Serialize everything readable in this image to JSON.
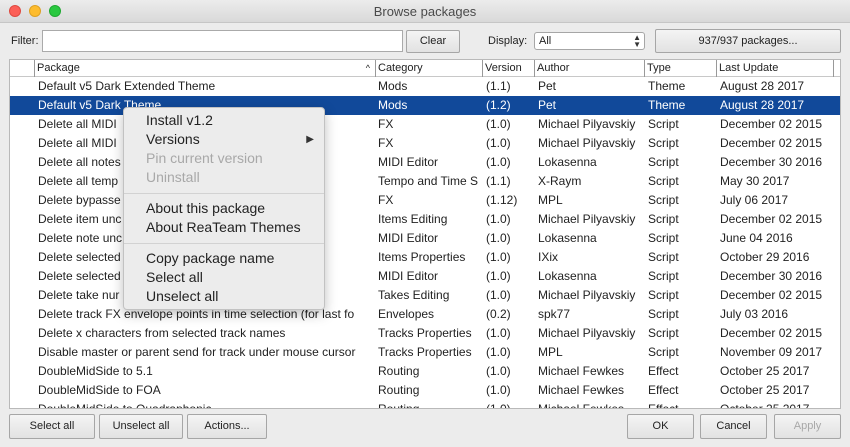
{
  "window": {
    "title": "Browse packages"
  },
  "filter": {
    "label": "Filter:",
    "value": "",
    "clear_label": "Clear"
  },
  "display": {
    "label": "Display:",
    "selected": "All"
  },
  "packages_button": "937/937 packages...",
  "columns": [
    "Package",
    "Category",
    "Version",
    "Author",
    "Type",
    "Last Update"
  ],
  "rows": [
    {
      "package": "Default v5 Dark Extended Theme",
      "category": "Mods",
      "version": "(1.1)",
      "author": "Pet",
      "type": "Theme",
      "updated": "August 28 2017"
    },
    {
      "package": "Default v5 Dark Theme",
      "category": "Mods",
      "version": "(1.2)",
      "author": "Pet",
      "type": "Theme",
      "updated": "August 28 2017",
      "selected": true
    },
    {
      "package": "Delete all MIDI",
      "category": "FX",
      "version": "(1.0)",
      "author": "Michael Pilyavskiy",
      "type": "Script",
      "updated": "December 02 2015"
    },
    {
      "package": "Delete all MIDI",
      "category": "FX",
      "version": "(1.0)",
      "author": "Michael Pilyavskiy",
      "type": "Script",
      "updated": "December 02 2015"
    },
    {
      "package": "Delete all notes",
      "category": "MIDI Editor",
      "version": "(1.0)",
      "author": "Lokasenna",
      "type": "Script",
      "updated": "December 30 2016"
    },
    {
      "package": "Delete all temp",
      "category": "Tempo and Time S",
      "version": "(1.1)",
      "author": "X-Raym",
      "type": "Script",
      "updated": "May 30 2017"
    },
    {
      "package": "Delete bypasse",
      "category": "FX",
      "version": "(1.12)",
      "author": "MPL",
      "type": "Script",
      "updated": "July 06 2017"
    },
    {
      "package": "Delete item unc",
      "category": "Items Editing",
      "version": "(1.0)",
      "author": "Michael Pilyavskiy",
      "type": "Script",
      "updated": "December 02 2015"
    },
    {
      "package": "Delete note unc",
      "category": "MIDI Editor",
      "version": "(1.0)",
      "author": "Lokasenna",
      "type": "Script",
      "updated": "June 04 2016"
    },
    {
      "package": "Delete selected",
      "category": "Items Properties",
      "version": "(1.0)",
      "author": "IXix",
      "type": "Script",
      "updated": "October 29 2016"
    },
    {
      "package": "Delete selected",
      "category": "MIDI Editor",
      "version": "(1.0)",
      "author": "Lokasenna",
      "type": "Script",
      "updated": "December 30 2016"
    },
    {
      "package": "Delete take nur",
      "category": "Takes Editing",
      "version": "(1.0)",
      "author": "Michael Pilyavskiy",
      "type": "Script",
      "updated": "December 02 2015"
    },
    {
      "package": "Delete track FX envelope points in time selection (for last fo",
      "category": "Envelopes",
      "version": "(0.2)",
      "author": "spk77",
      "type": "Script",
      "updated": "July 03 2016"
    },
    {
      "package": "Delete x characters from selected track names",
      "category": "Tracks Properties",
      "version": "(1.0)",
      "author": "Michael Pilyavskiy",
      "type": "Script",
      "updated": "December 02 2015"
    },
    {
      "package": "Disable master or parent send for track under mouse cursor",
      "category": "Tracks Properties",
      "version": "(1.0)",
      "author": "MPL",
      "type": "Script",
      "updated": "November 09 2017"
    },
    {
      "package": "DoubleMidSide to 5.1",
      "category": "Routing",
      "version": "(1.0)",
      "author": "Michael Fewkes",
      "type": "Effect",
      "updated": "October 25 2017"
    },
    {
      "package": "DoubleMidSide to FOA",
      "category": "Routing",
      "version": "(1.0)",
      "author": "Michael Fewkes",
      "type": "Effect",
      "updated": "October 25 2017"
    },
    {
      "package": "DoubleMidSide to Quadraphonic",
      "category": "Routing",
      "version": "(1.0)",
      "author": "Michael Fewkes",
      "type": "Effect",
      "updated": "October 25 2017"
    }
  ],
  "context_menu": {
    "install": "Install v1.2",
    "versions": "Versions",
    "pin": "Pin current version",
    "uninstall": "Uninstall",
    "about_package": "About this package",
    "about_author": "About ReaTeam Themes",
    "copy_name": "Copy package name",
    "select_all": "Select all",
    "unselect_all": "Unselect all"
  },
  "footer": {
    "select_all": "Select all",
    "unselect_all": "Unselect all",
    "actions": "Actions...",
    "ok": "OK",
    "cancel": "Cancel",
    "apply": "Apply"
  },
  "colors": {
    "selection": "#11499a",
    "window_bg": "#ececec"
  }
}
